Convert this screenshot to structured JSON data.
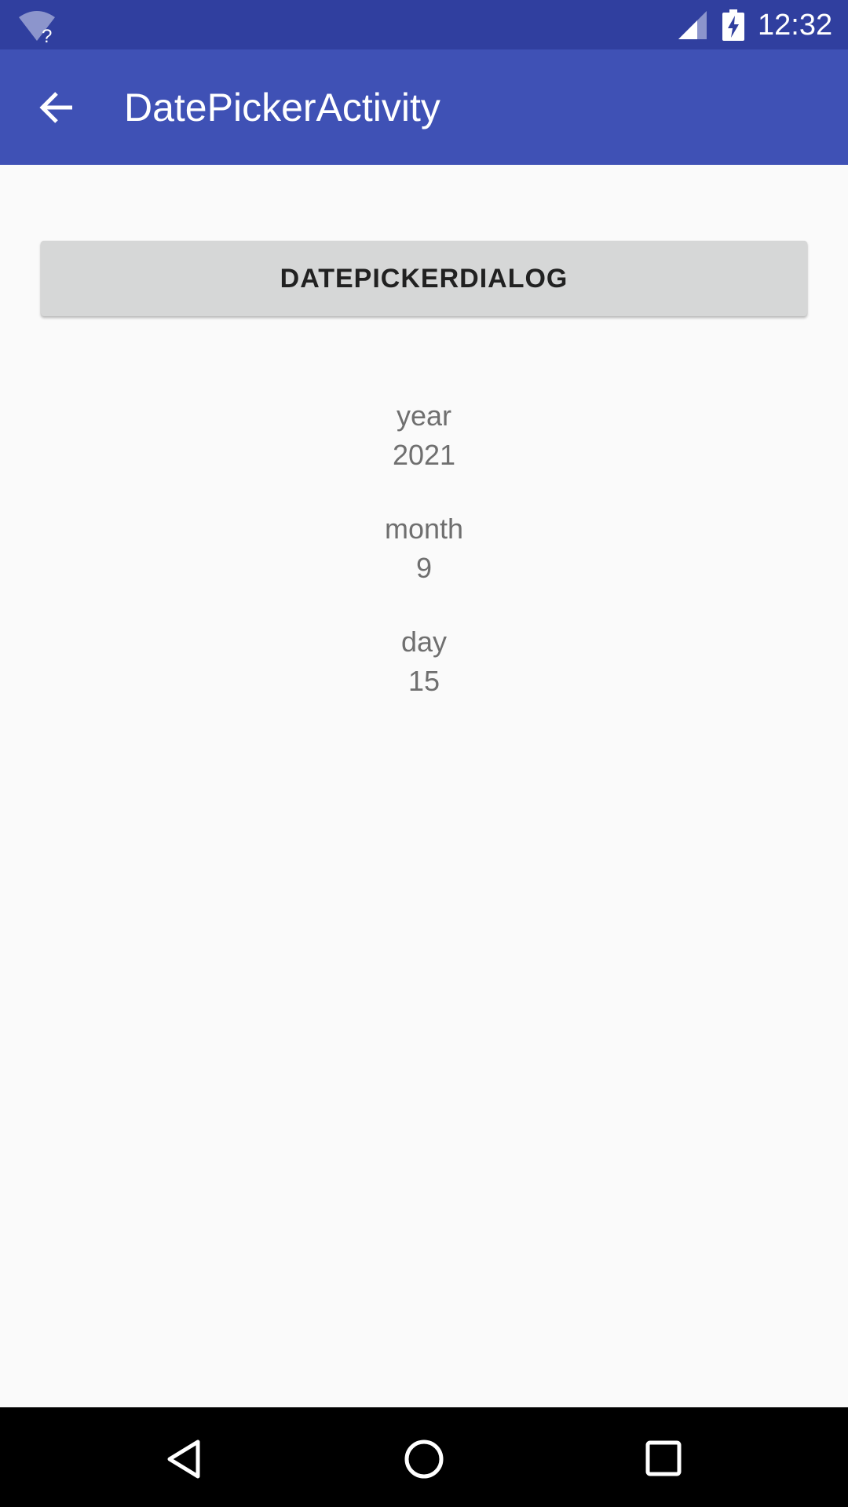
{
  "status_bar": {
    "time": "12:32",
    "icons": [
      "wifi-unknown-icon",
      "cell-signal-icon",
      "battery-charging-icon"
    ]
  },
  "app_bar": {
    "title": "DatePickerActivity",
    "back_icon": "arrow-back-icon"
  },
  "main": {
    "button_label": "DATEPICKERDIALOG",
    "year_label": "year",
    "year_value": "2021",
    "month_label": "month",
    "month_value": "9",
    "day_label": "day",
    "day_value": "15"
  },
  "nav_bar": {
    "icons": [
      "nav-back-icon",
      "nav-home-icon",
      "nav-recents-icon"
    ]
  },
  "colors": {
    "status_bar": "#303f9f",
    "app_bar": "#3f51b5",
    "background": "#fafafa",
    "button": "#d6d7d7",
    "secondary_text": "#6f6f6f"
  }
}
